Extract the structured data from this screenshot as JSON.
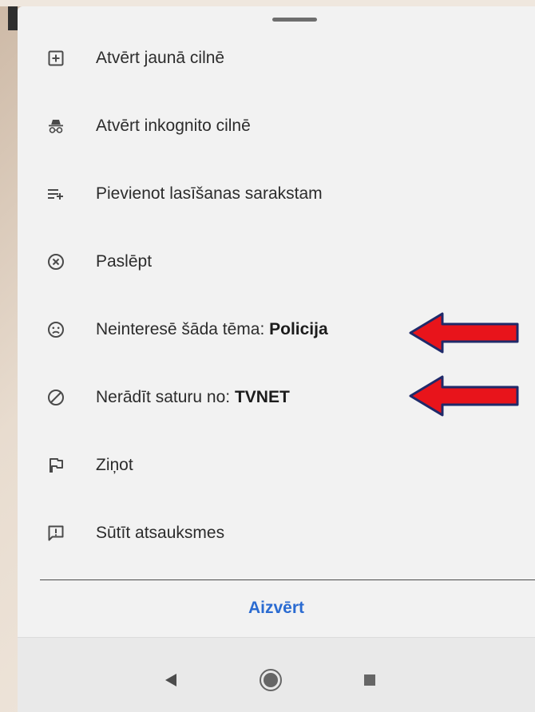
{
  "menu": {
    "items": [
      {
        "icon": "add-box-icon",
        "label": "Atvērt jaunā cilnē",
        "bold": ""
      },
      {
        "icon": "incognito-icon",
        "label": "Atvērt inkognito cilnē",
        "bold": ""
      },
      {
        "icon": "playlist-add-icon",
        "label": "Pievienot lasīšanas sarakstam",
        "bold": ""
      },
      {
        "icon": "cancel-circle-icon",
        "label": "Paslēpt",
        "bold": ""
      },
      {
        "icon": "sad-face-icon",
        "label": "Neinteresē šāda tēma: ",
        "bold": "Policija"
      },
      {
        "icon": "block-icon",
        "label": "Nerādīt saturu no: ",
        "bold": "TVNET"
      },
      {
        "icon": "flag-icon",
        "label": "Ziņot",
        "bold": ""
      },
      {
        "icon": "feedback-icon",
        "label": "Sūtīt atsauksmes",
        "bold": ""
      }
    ]
  },
  "close_label": "Aizvērt",
  "nav": {
    "back_icon": "back-triangle-icon",
    "home_icon": "home-circle-icon",
    "recents_icon": "recents-square-icon"
  },
  "colors": {
    "accent": "#2a6bd1",
    "arrow": "#e8141b"
  }
}
